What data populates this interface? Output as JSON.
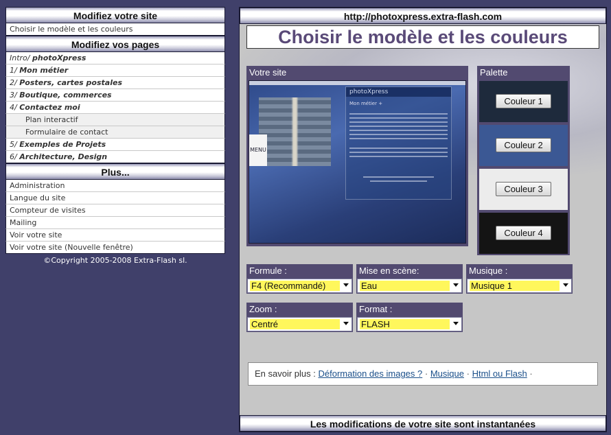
{
  "sidebar": {
    "site_header": "Modifiez votre site",
    "site_items": [
      {
        "label": "Choisir le modèle et les couleurs"
      }
    ],
    "pages_header": "Modifiez vos pages",
    "page_items": [
      {
        "num": "Intro/",
        "label": "photoXpress"
      },
      {
        "num": "1/",
        "label": "Mon métier"
      },
      {
        "num": "2/",
        "label": "Posters, cartes postales"
      },
      {
        "num": "3/",
        "label": "Boutique, commerces"
      },
      {
        "num": "4/",
        "label": "Contactez moi"
      }
    ],
    "sub_items": [
      {
        "label": "Plan interactif"
      },
      {
        "label": "Formulaire de contact"
      }
    ],
    "page_items_2": [
      {
        "num": "5/",
        "label": "Exemples de Projets"
      },
      {
        "num": "6/",
        "label": "Architecture, Design"
      }
    ],
    "plus_header": "Plus...",
    "plus_items": [
      {
        "label": "Administration"
      },
      {
        "label": "Langue du site"
      },
      {
        "label": "Compteur de visites"
      },
      {
        "label": "Mailing"
      },
      {
        "label": "Voir votre site"
      },
      {
        "label": "Voir votre site (Nouvelle fenêtre)"
      }
    ],
    "copyright": "©Copyright 2005-2008 Extra-Flash sl."
  },
  "main": {
    "url": "http://photoxpress.extra-flash.com",
    "title": "Choisir le modèle et les couleurs",
    "preview": {
      "label": "Votre site",
      "brand": "photoXpress",
      "menu_label": "MENU",
      "sub_heading": "Mon métier +"
    },
    "palette": {
      "label": "Palette",
      "colors": [
        {
          "label": "Couleur 1",
          "color": "#1e2a3c"
        },
        {
          "label": "Couleur 2",
          "color": "#3b5894"
        },
        {
          "label": "Couleur 3",
          "color": "#ececec"
        },
        {
          "label": "Couleur 4",
          "color": "#141414"
        }
      ]
    },
    "selects": {
      "formule": {
        "label": "Formule :",
        "value": "F4 (Recommandé)"
      },
      "mise_en_scene": {
        "label": "Mise en scène:",
        "value": "Eau"
      },
      "musique": {
        "label": "Musique :",
        "value": "Musique 1"
      },
      "zoom": {
        "label": "Zoom :",
        "value": "Centré"
      },
      "format": {
        "label": "Format :",
        "value": "FLASH"
      }
    },
    "info": {
      "prefix": "En savoir plus :",
      "links": [
        "Déformation des images ?",
        "Musique",
        "Html ou Flash"
      ],
      "separator": "·"
    },
    "footer": "Les modifications de votre site sont instantanées"
  },
  "colors": {
    "page_bg": "#40406a",
    "box_header": "#524a70",
    "highlight": "#fff75c",
    "link": "#1a4f8a"
  }
}
